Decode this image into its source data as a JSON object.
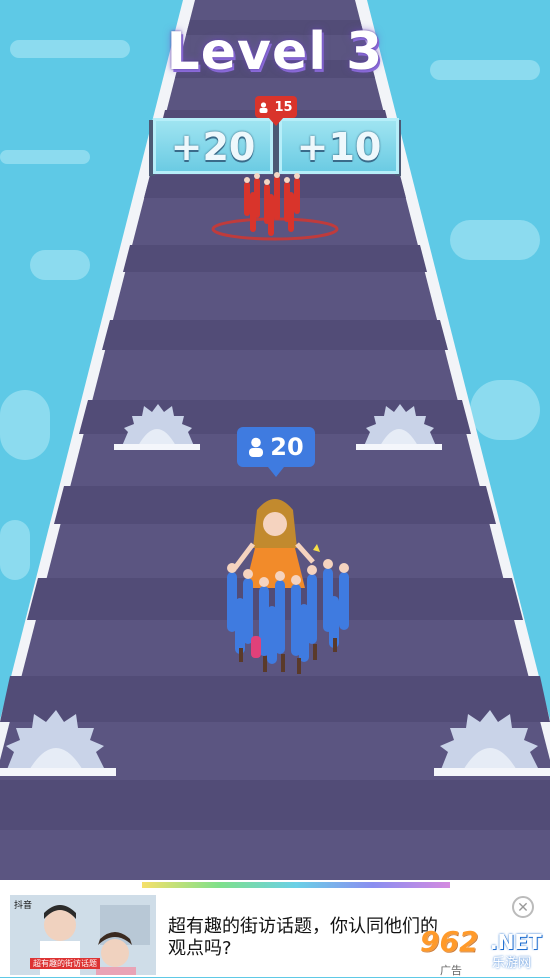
{
  "hud": {
    "level_title": "Level 3"
  },
  "gates": {
    "left_label": "+20",
    "right_label": "+10"
  },
  "enemy_crowd": {
    "count": "15",
    "color": "#d9342b"
  },
  "player_crowd": {
    "count": "20",
    "color": "#3f7be0"
  },
  "ad": {
    "source": "抖音",
    "caption": "超有趣的街访话题",
    "text": "超有趣的街访话题，你认同他们的观点吗?",
    "tag": "广告",
    "close_icon": "close-icon"
  },
  "watermark": {
    "number": "962",
    "suffix": ".NET",
    "subtitle": "乐游网"
  },
  "colors": {
    "water": "#5ec9e6",
    "road": "#5b5581",
    "gate": "#7fd6ea"
  }
}
